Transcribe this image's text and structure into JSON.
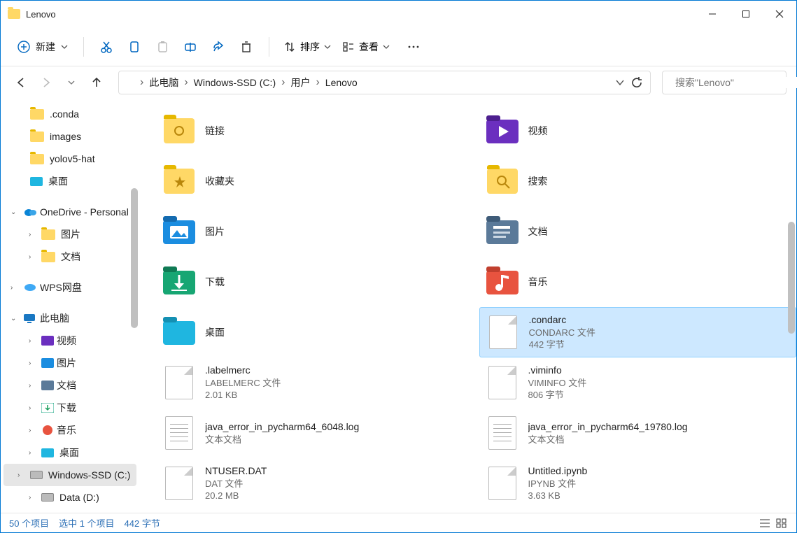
{
  "titlebar": {
    "title": "Lenovo"
  },
  "toolbar": {
    "new_label": "新建",
    "sort_label": "排序",
    "view_label": "查看"
  },
  "breadcrumbs": [
    "此电脑",
    "Windows-SSD (C:)",
    "用户",
    "Lenovo"
  ],
  "search": {
    "placeholder": "搜索\"Lenovo\""
  },
  "sidebar": {
    "section0": [
      ".conda",
      "images",
      "yolov5-hat",
      "桌面"
    ],
    "onedrive": {
      "label": "OneDrive - Personal",
      "children": [
        "图片",
        "文档"
      ]
    },
    "wps": "WPS网盘",
    "thispc": {
      "label": "此电脑",
      "children": [
        "视频",
        "图片",
        "文档",
        "下载",
        "音乐",
        "桌面",
        "Windows-SSD (C:)",
        "Data (D:)"
      ]
    }
  },
  "items": {
    "left": [
      {
        "name": "链接",
        "type": "folder-link"
      },
      {
        "name": "收藏夹",
        "type": "folder-fav"
      },
      {
        "name": "图片",
        "type": "folder-pictures"
      },
      {
        "name": "下载",
        "type": "folder-downloads"
      },
      {
        "name": "桌面",
        "type": "folder-desktop"
      },
      {
        "name": ".labelmerc",
        "type": "file",
        "sub1": "LABELMERC 文件",
        "sub2": "2.01 KB"
      },
      {
        "name": "java_error_in_pycharm64_6048.log",
        "type": "textfile",
        "sub1": "文本文档"
      },
      {
        "name": "NTUSER.DAT",
        "type": "file",
        "sub1": "DAT 文件",
        "sub2": "20.2 MB"
      }
    ],
    "right": [
      {
        "name": "视频",
        "type": "folder-video"
      },
      {
        "name": "搜索",
        "type": "folder-search"
      },
      {
        "name": "文档",
        "type": "folder-docs"
      },
      {
        "name": "音乐",
        "type": "folder-music"
      },
      {
        "name": ".condarc",
        "type": "file",
        "sub1": "CONDARC 文件",
        "sub2": "442 字节",
        "selected": true
      },
      {
        "name": ".viminfo",
        "type": "file",
        "sub1": "VIMINFO 文件",
        "sub2": "806 字节"
      },
      {
        "name": "java_error_in_pycharm64_19780.log",
        "type": "textfile",
        "sub1": "文本文档"
      },
      {
        "name": "Untitled.ipynb",
        "type": "file",
        "sub1": "IPYNB 文件",
        "sub2": "3.63 KB"
      }
    ]
  },
  "statusbar": {
    "count": "50 个项目",
    "selected": "选中 1 个项目",
    "size": "442 字节"
  }
}
